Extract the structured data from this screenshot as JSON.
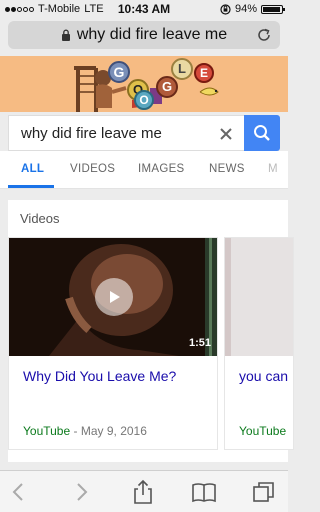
{
  "status_bar": {
    "carrier": "T-Mobile",
    "network": "LTE",
    "time": "10:43 AM",
    "battery_percent": "94%",
    "battery_level": 0.94,
    "signal_bars_filled": 2,
    "signal_bars_total": 5
  },
  "url_bar": {
    "text": "why did fire leave me"
  },
  "doodle": {
    "letters": [
      "G",
      "O",
      "O",
      "G",
      "L",
      "E"
    ]
  },
  "search": {
    "query": "why did fire leave me"
  },
  "tabs": [
    {
      "label": "ALL",
      "active": true
    },
    {
      "label": "VIDEOS"
    },
    {
      "label": "IMAGES"
    },
    {
      "label": "NEWS"
    },
    {
      "label": "M"
    }
  ],
  "videos": {
    "heading": "Videos",
    "items": [
      {
        "title": "Why Did You Leave Me?",
        "source": "YouTube",
        "date": "May 9, 2016",
        "duration": "1:51"
      },
      {
        "title": "you can",
        "source": "YouTube"
      }
    ]
  },
  "colors": {
    "accent": "#4285f4",
    "link": "#1a0dab",
    "source": "#0b7a1c",
    "doodle_bg": "#f6bb83"
  }
}
